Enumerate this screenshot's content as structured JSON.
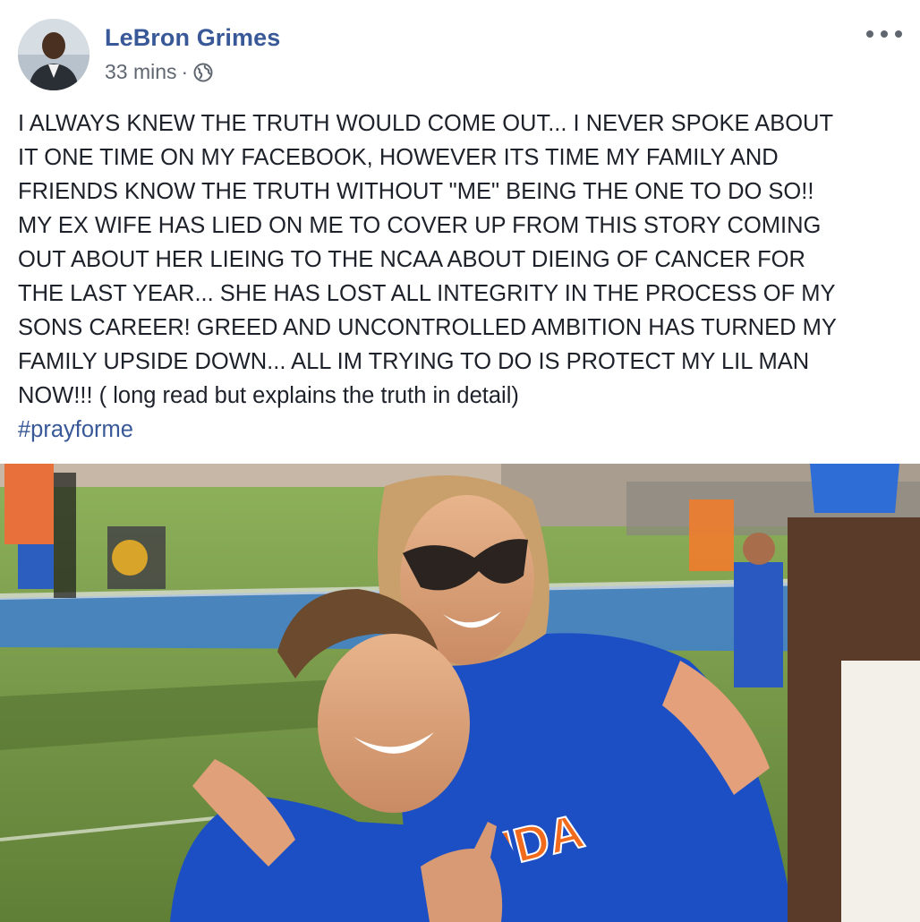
{
  "post": {
    "author": "LeBron Grimes",
    "timestamp": "33 mins",
    "separator": "·",
    "privacy_icon": "globe-icon",
    "menu_icon": "more-options-icon",
    "text_lines": [
      "I ALWAYS KNEW THE TRUTH WOULD COME OUT... I NEVER SPOKE ABOUT",
      "IT ONE TIME ON MY FACEBOOK, HOWEVER ITS TIME MY FAMILY AND",
      "FRIENDS KNOW THE TRUTH WITHOUT \"ME\" BEING THE ONE TO DO SO!!",
      "MY EX WIFE HAS LIED ON ME TO COVER UP FROM THIS STORY COMING",
      "OUT ABOUT HER LIEING TO THE NCAA ABOUT DIEING OF CANCER FOR",
      "THE LAST YEAR... SHE HAS LOST ALL INTEGRITY IN THE PROCESS OF MY",
      "SONS CAREER! GREED AND UNCONTROLLED AMBITION HAS TURNED MY",
      "FAMILY UPSIDE DOWN... ALL IM TRYING TO DO IS PROTECT MY LIL MAN",
      "NOW!!! ( long read but explains the truth in detail)"
    ],
    "hashtag": "#prayforme",
    "photo_text": "RIDA"
  },
  "colors": {
    "link": "#385898",
    "text": "#1d2129",
    "meta": "#606770",
    "jersey_blue": "#1c4fc4",
    "jersey_orange": "#f26b1d",
    "turf_green": "#6a8f3c"
  }
}
